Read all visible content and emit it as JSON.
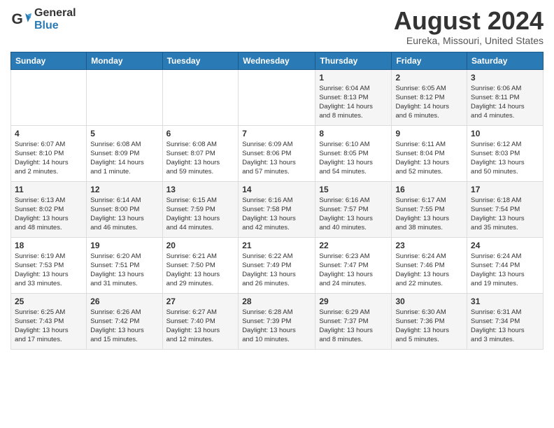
{
  "header": {
    "logo": {
      "general": "General",
      "blue": "Blue"
    },
    "title": "August 2024",
    "subtitle": "Eureka, Missouri, United States"
  },
  "calendar": {
    "days_of_week": [
      "Sunday",
      "Monday",
      "Tuesday",
      "Wednesday",
      "Thursday",
      "Friday",
      "Saturday"
    ],
    "weeks": [
      [
        {
          "day": "",
          "info": ""
        },
        {
          "day": "",
          "info": ""
        },
        {
          "day": "",
          "info": ""
        },
        {
          "day": "",
          "info": ""
        },
        {
          "day": "1",
          "info": "Sunrise: 6:04 AM\nSunset: 8:13 PM\nDaylight: 14 hours\nand 8 minutes."
        },
        {
          "day": "2",
          "info": "Sunrise: 6:05 AM\nSunset: 8:12 PM\nDaylight: 14 hours\nand 6 minutes."
        },
        {
          "day": "3",
          "info": "Sunrise: 6:06 AM\nSunset: 8:11 PM\nDaylight: 14 hours\nand 4 minutes."
        }
      ],
      [
        {
          "day": "4",
          "info": "Sunrise: 6:07 AM\nSunset: 8:10 PM\nDaylight: 14 hours\nand 2 minutes."
        },
        {
          "day": "5",
          "info": "Sunrise: 6:08 AM\nSunset: 8:09 PM\nDaylight: 14 hours\nand 1 minute."
        },
        {
          "day": "6",
          "info": "Sunrise: 6:08 AM\nSunset: 8:07 PM\nDaylight: 13 hours\nand 59 minutes."
        },
        {
          "day": "7",
          "info": "Sunrise: 6:09 AM\nSunset: 8:06 PM\nDaylight: 13 hours\nand 57 minutes."
        },
        {
          "day": "8",
          "info": "Sunrise: 6:10 AM\nSunset: 8:05 PM\nDaylight: 13 hours\nand 54 minutes."
        },
        {
          "day": "9",
          "info": "Sunrise: 6:11 AM\nSunset: 8:04 PM\nDaylight: 13 hours\nand 52 minutes."
        },
        {
          "day": "10",
          "info": "Sunrise: 6:12 AM\nSunset: 8:03 PM\nDaylight: 13 hours\nand 50 minutes."
        }
      ],
      [
        {
          "day": "11",
          "info": "Sunrise: 6:13 AM\nSunset: 8:02 PM\nDaylight: 13 hours\nand 48 minutes."
        },
        {
          "day": "12",
          "info": "Sunrise: 6:14 AM\nSunset: 8:00 PM\nDaylight: 13 hours\nand 46 minutes."
        },
        {
          "day": "13",
          "info": "Sunrise: 6:15 AM\nSunset: 7:59 PM\nDaylight: 13 hours\nand 44 minutes."
        },
        {
          "day": "14",
          "info": "Sunrise: 6:16 AM\nSunset: 7:58 PM\nDaylight: 13 hours\nand 42 minutes."
        },
        {
          "day": "15",
          "info": "Sunrise: 6:16 AM\nSunset: 7:57 PM\nDaylight: 13 hours\nand 40 minutes."
        },
        {
          "day": "16",
          "info": "Sunrise: 6:17 AM\nSunset: 7:55 PM\nDaylight: 13 hours\nand 38 minutes."
        },
        {
          "day": "17",
          "info": "Sunrise: 6:18 AM\nSunset: 7:54 PM\nDaylight: 13 hours\nand 35 minutes."
        }
      ],
      [
        {
          "day": "18",
          "info": "Sunrise: 6:19 AM\nSunset: 7:53 PM\nDaylight: 13 hours\nand 33 minutes."
        },
        {
          "day": "19",
          "info": "Sunrise: 6:20 AM\nSunset: 7:51 PM\nDaylight: 13 hours\nand 31 minutes."
        },
        {
          "day": "20",
          "info": "Sunrise: 6:21 AM\nSunset: 7:50 PM\nDaylight: 13 hours\nand 29 minutes."
        },
        {
          "day": "21",
          "info": "Sunrise: 6:22 AM\nSunset: 7:49 PM\nDaylight: 13 hours\nand 26 minutes."
        },
        {
          "day": "22",
          "info": "Sunrise: 6:23 AM\nSunset: 7:47 PM\nDaylight: 13 hours\nand 24 minutes."
        },
        {
          "day": "23",
          "info": "Sunrise: 6:24 AM\nSunset: 7:46 PM\nDaylight: 13 hours\nand 22 minutes."
        },
        {
          "day": "24",
          "info": "Sunrise: 6:24 AM\nSunset: 7:44 PM\nDaylight: 13 hours\nand 19 minutes."
        }
      ],
      [
        {
          "day": "25",
          "info": "Sunrise: 6:25 AM\nSunset: 7:43 PM\nDaylight: 13 hours\nand 17 minutes."
        },
        {
          "day": "26",
          "info": "Sunrise: 6:26 AM\nSunset: 7:42 PM\nDaylight: 13 hours\nand 15 minutes."
        },
        {
          "day": "27",
          "info": "Sunrise: 6:27 AM\nSunset: 7:40 PM\nDaylight: 13 hours\nand 12 minutes."
        },
        {
          "day": "28",
          "info": "Sunrise: 6:28 AM\nSunset: 7:39 PM\nDaylight: 13 hours\nand 10 minutes."
        },
        {
          "day": "29",
          "info": "Sunrise: 6:29 AM\nSunset: 7:37 PM\nDaylight: 13 hours\nand 8 minutes."
        },
        {
          "day": "30",
          "info": "Sunrise: 6:30 AM\nSunset: 7:36 PM\nDaylight: 13 hours\nand 5 minutes."
        },
        {
          "day": "31",
          "info": "Sunrise: 6:31 AM\nSunset: 7:34 PM\nDaylight: 13 hours\nand 3 minutes."
        }
      ]
    ]
  }
}
